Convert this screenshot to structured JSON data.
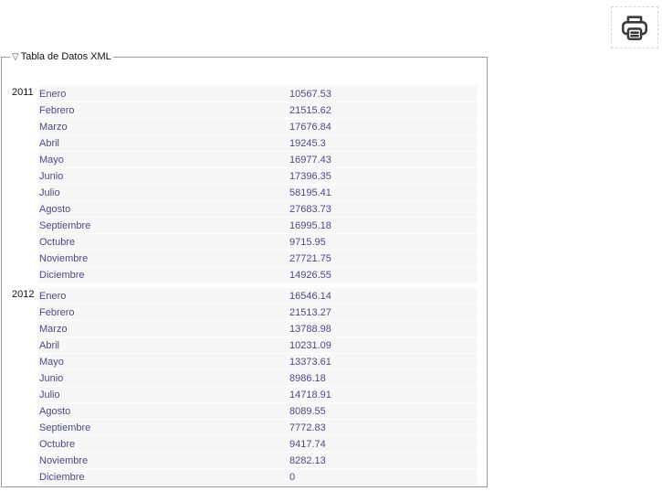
{
  "colors": {
    "row_text": "#4c4a86",
    "row_background": "#f7f7f7",
    "border": "#9a9a9a"
  },
  "toolbar": {
    "print_icon": "printer-icon"
  },
  "table": {
    "legend": "Tabla de Datos XML",
    "toggle_glyph": "▽",
    "years": [
      {
        "year": "2011",
        "rows": [
          {
            "month": "Enero",
            "value": "10567.53"
          },
          {
            "month": "Febrero",
            "value": "21515.62"
          },
          {
            "month": "Marzo",
            "value": "17676.84"
          },
          {
            "month": "Abril",
            "value": "19245.3"
          },
          {
            "month": "Mayo",
            "value": "16977.43"
          },
          {
            "month": "Junio",
            "value": "17396.35"
          },
          {
            "month": "Julio",
            "value": "58195.41"
          },
          {
            "month": "Agosto",
            "value": "27683.73"
          },
          {
            "month": "Septiembre",
            "value": "16995.18"
          },
          {
            "month": "Octubre",
            "value": "9715.95"
          },
          {
            "month": "Noviembre",
            "value": "27721.75"
          },
          {
            "month": "Diciembre",
            "value": "14926.55"
          }
        ]
      },
      {
        "year": "2012",
        "rows": [
          {
            "month": "Enero",
            "value": "16546.14"
          },
          {
            "month": "Febrero",
            "value": "21513.27"
          },
          {
            "month": "Marzo",
            "value": "13788.98"
          },
          {
            "month": "Abril",
            "value": "10231.09"
          },
          {
            "month": "Mayo",
            "value": "13373.61"
          },
          {
            "month": "Junio",
            "value": "8986.18"
          },
          {
            "month": "Julio",
            "value": "14718.91"
          },
          {
            "month": "Agosto",
            "value": "8089.55"
          },
          {
            "month": "Septiembre",
            "value": "7772.83"
          },
          {
            "month": "Octubre",
            "value": "9417.74"
          },
          {
            "month": "Noviembre",
            "value": "8282.13"
          },
          {
            "month": "Diciembre",
            "value": "0"
          }
        ]
      }
    ]
  }
}
